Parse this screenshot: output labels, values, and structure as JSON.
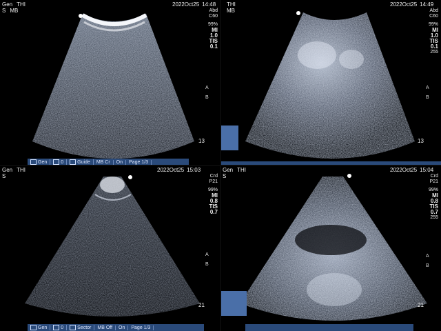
{
  "quadrants": [
    {
      "preset": "Gen",
      "mode": "THI",
      "line2a": "S",
      "line2b": "MB",
      "date": "2022Oct25",
      "time": "14:48",
      "side": [
        "Abd",
        "C60",
        "",
        "99%",
        "MI",
        "1.0",
        "TIS",
        "0.1"
      ],
      "focus_a": "A",
      "focus_b": "B",
      "depth": "13",
      "toolbar": [
        "Gen",
        "0",
        "Guide",
        "MB Cr",
        "On",
        "Page 1/3"
      ]
    },
    {
      "preset": "",
      "mode": "THI",
      "line2a": "",
      "line2b": "MB",
      "date": "2022Oct25",
      "time": "14:49",
      "side": [
        "Abd",
        "C60",
        "",
        "99%",
        "MI",
        "1.0",
        "TIS",
        "0.1",
        "255"
      ],
      "focus_a": "A",
      "focus_b": "B",
      "depth": "13",
      "toolbar": [
        "",
        "",
        "",
        "",
        "",
        ""
      ]
    },
    {
      "preset": "Gen",
      "mode": "THI",
      "line2a": "S",
      "line2b": "",
      "date": "2022Oct25",
      "time": "15:03",
      "side": [
        "Crd",
        "P21",
        "",
        "99%",
        "MI",
        "0.8",
        "TIS",
        "0.7"
      ],
      "focus_a": "A",
      "focus_b": "B",
      "depth": "21",
      "toolbar": [
        "Gen",
        "0",
        "Sector",
        "MB Off",
        "On",
        "Page 1/3"
      ]
    },
    {
      "preset": "Gen",
      "mode": "THI",
      "line2a": "S",
      "line2b": "",
      "date": "2022Oct25",
      "time": "15:04",
      "side": [
        "Crd",
        "P21",
        "",
        "99%",
        "MI",
        "0.8",
        "TIS",
        "0.7",
        "255"
      ],
      "focus_a": "A",
      "focus_b": "B",
      "depth": "21",
      "toolbar": [
        "",
        "",
        "",
        "",
        "",
        ""
      ]
    }
  ],
  "colors": {
    "background": "#000000",
    "toolbar": "#2a4a7a",
    "text": "#f0f0f0"
  },
  "icons": [
    "probe-orientation-dot",
    "focus-marker",
    "trackball-icon"
  ]
}
